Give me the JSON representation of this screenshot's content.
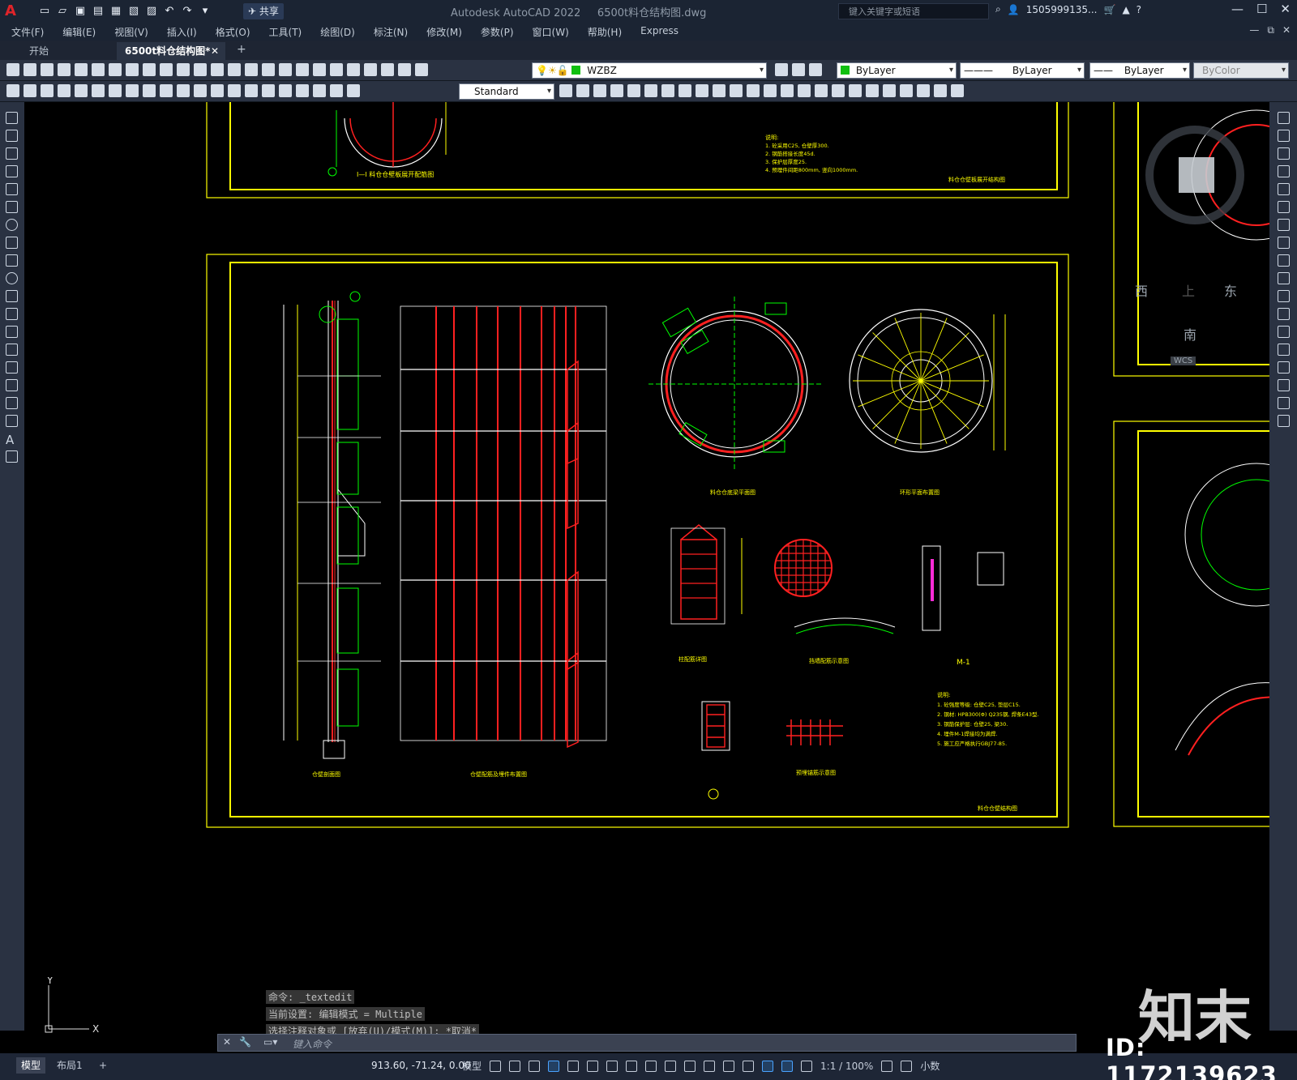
{
  "titlebar": {
    "app_title": "Autodesk AutoCAD 2022",
    "file_title": "6500t料仓结构图.dwg",
    "share_label": "共享",
    "search_placeholder": "键入关键字或短语",
    "user": "1505999135...",
    "app_logo": "A"
  },
  "menu": [
    "文件(F)",
    "编辑(E)",
    "视图(V)",
    "插入(I)",
    "格式(O)",
    "工具(T)",
    "绘图(D)",
    "标注(N)",
    "修改(M)",
    "参数(P)",
    "窗口(W)",
    "帮助(H)",
    "Express"
  ],
  "tabs": [
    {
      "label": "开始"
    },
    {
      "label": "6500t料仓结构图*"
    }
  ],
  "toolbar": {
    "layer_name": "WZBZ",
    "layer_color": "#10c010",
    "color_combo": "ByLayer",
    "linetype_combo": "ByLayer",
    "lineweight_combo": "ByLayer",
    "plotstyle_combo": "ByColor",
    "textstyle_combo": "Standard"
  },
  "viewcube": {
    "west": "西",
    "top": "上",
    "east": "东",
    "south": "南",
    "wcs": "WCS"
  },
  "drawing": {
    "sheet_title_top": "料仓仓壁板展开结构图",
    "sheet_title_main": "料仓仓壁结构图",
    "label_wall_elev": "仓壁剖面图",
    "label_wall_rebar": "仓壁配筋及埋件布置图",
    "label_silo_plan": "料仓仓底梁平面图",
    "label_ring_plan": "环形平面布置图",
    "label_column": "柱配筋详图",
    "label_mesh": "挡墙配筋示意图",
    "label_m1": "M-1",
    "label_anchor": "预埋锚筋示意图",
    "notes_heading": "说明:",
    "notes": [
      "1. 砼强度等级: 仓壁C25, 垫层C15.",
      "2. 钢材: HPB300(Φ) Q235钢, 焊条E43型.",
      "3. 钢筋保护层: 仓壁25, 梁30.",
      "4. 埋件M-1焊接均为满焊.",
      "5. 施工应严格执行GBJ77-85."
    ],
    "top_notes": [
      "1. 砼采用C25, 仓壁厚300.",
      "2. 钢筋搭接长度45d.",
      "3. 保护层厚度25.",
      "4. 预埋件间距800mm, 竖向1000mm."
    ]
  },
  "command": {
    "history": [
      "命令: _textedit",
      "当前设置: 编辑模式 = Multiple",
      "选择注释对象或 [放弃(U)/模式(M)]: *取消*"
    ],
    "placeholder": "键入命令"
  },
  "status": {
    "layout_tabs": [
      "模型",
      "布局1"
    ],
    "coords": "913.60, -71.24, 0.00",
    "mode": "模型",
    "scale": "1:1 / 100%",
    "units": "小数"
  },
  "watermark": {
    "brand": "知末",
    "id": "ID: 1172139623"
  }
}
